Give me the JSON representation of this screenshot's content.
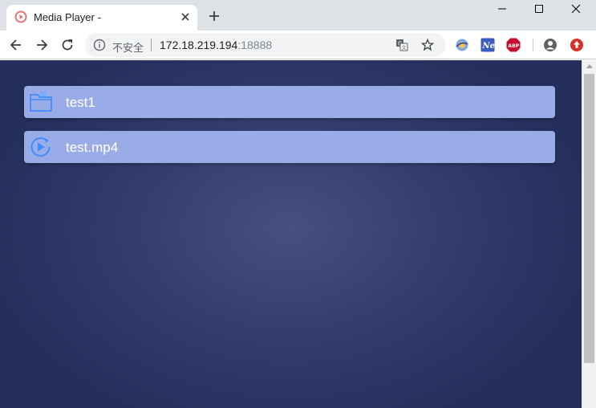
{
  "browser": {
    "tab": {
      "title": "Media Player -",
      "favicon": "media-player-icon"
    },
    "window_controls": [
      "minimize-icon",
      "maximize-icon",
      "close-icon"
    ],
    "toolbar": {
      "back": "back-arrow-icon",
      "forward": "forward-arrow-icon",
      "reload": "reload-icon"
    },
    "omnibox": {
      "security_label": "不安全",
      "url_host": "172.18.219.194",
      "url_port": ":18888"
    },
    "extensions": [
      "translate-icon",
      "bookmark-star-icon",
      "extension-globe-icon",
      "extension-ne-icon",
      "adblock-plus-icon",
      "profile-avatar-icon",
      "update-arrow-icon"
    ]
  },
  "page": {
    "items": [
      {
        "label": "test1",
        "icon": "folder-icon",
        "type": "folder"
      },
      {
        "label": "test.mp4",
        "icon": "video-play-icon",
        "type": "video"
      }
    ]
  },
  "colors": {
    "item_background": "#9aace8",
    "page_background": "#2f3968",
    "icon_blue": "#3f8cff"
  }
}
